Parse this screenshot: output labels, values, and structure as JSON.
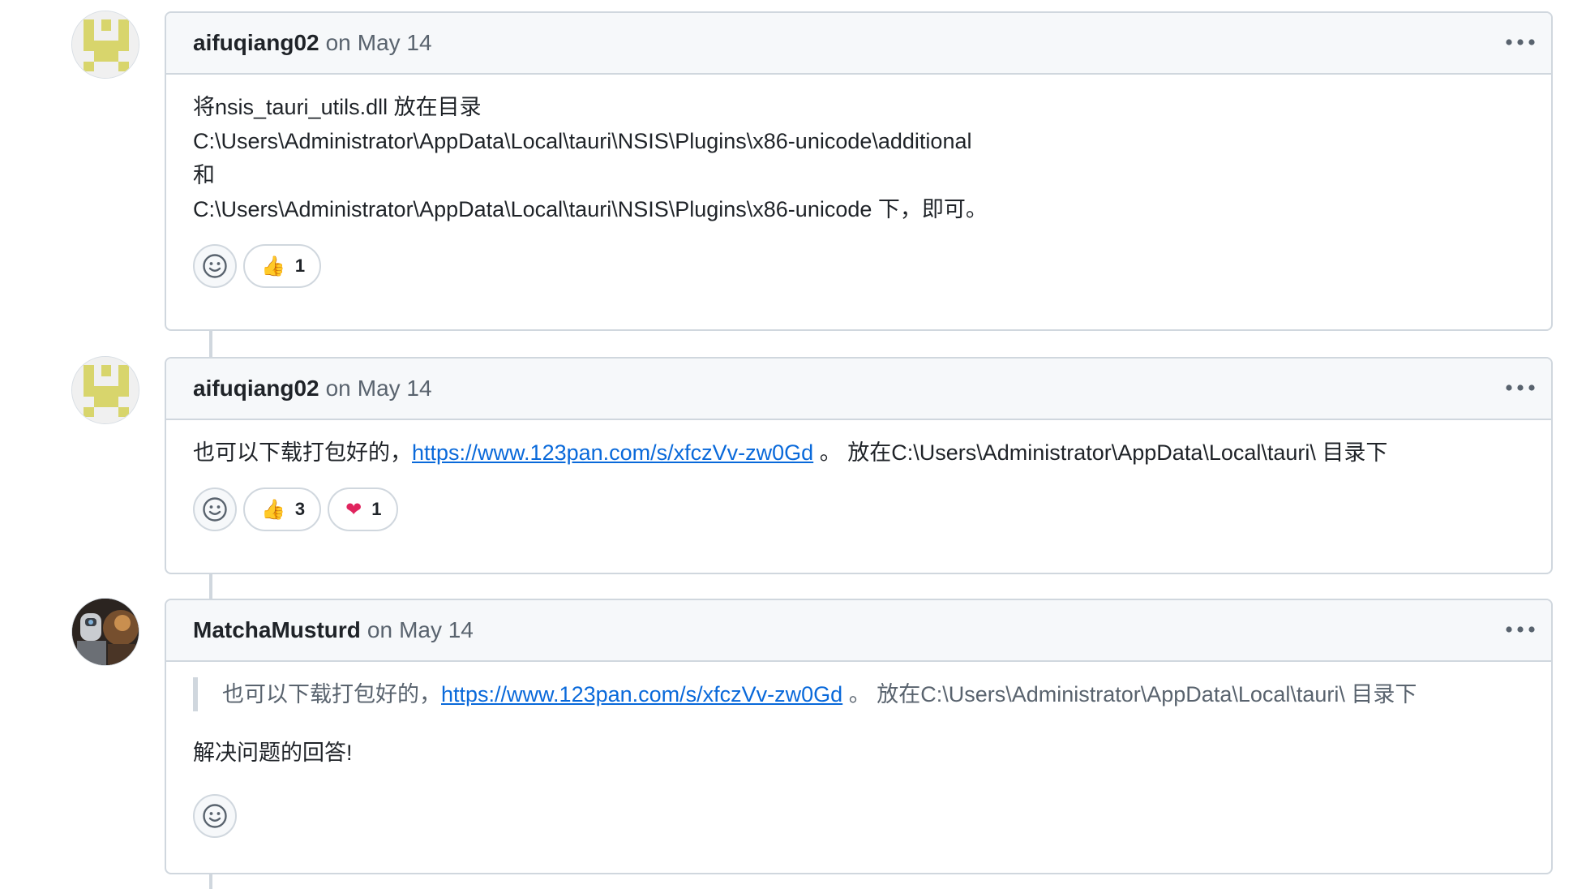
{
  "comments": [
    {
      "author": "aifuqiang02",
      "on_word": "on",
      "date": "May 14",
      "lines": [
        "将nsis_tauri_utils.dll 放在目录",
        "C:\\Users\\Administrator\\AppData\\Local\\tauri\\NSIS\\Plugins\\x86-unicode\\additional",
        "和",
        "C:\\Users\\Administrator\\AppData\\Local\\tauri\\NSIS\\Plugins\\x86-unicode 下，即可。"
      ],
      "reactions": [
        {
          "emoji": "👍",
          "icon": "thumbs-up-icon",
          "count": "1"
        }
      ]
    },
    {
      "author": "aifuqiang02",
      "on_word": "on",
      "date": "May 14",
      "text_before": "也可以下载打包好的，",
      "link": "https://www.123pan.com/s/xfczVv-zw0Gd",
      "text_after": " 。 放在C:\\Users\\Administrator\\AppData\\Local\\tauri\\ 目录下",
      "reactions": [
        {
          "emoji": "👍",
          "icon": "thumbs-up-icon",
          "count": "3"
        },
        {
          "emoji": "❤",
          "icon": "heart-icon",
          "count": "1"
        }
      ]
    },
    {
      "author": "MatchaMusturd",
      "on_word": "on",
      "date": "May 14",
      "quote_before": "也可以下载打包好的，",
      "quote_link": "https://www.123pan.com/s/xfczVv-zw0Gd",
      "quote_after": " 。 放在C:\\Users\\Administrator\\AppData\\Local\\tauri\\ 目录下",
      "reply": "解决问题的回答!"
    }
  ],
  "colors": {
    "link": "#0969da",
    "border": "#d0d7de",
    "header_bg": "#f6f8fa",
    "muted": "#59636e",
    "identicon": "#d8d56c"
  },
  "icons": {
    "add_reaction": "smiley-icon",
    "menu": "kebab-horizontal-icon"
  }
}
